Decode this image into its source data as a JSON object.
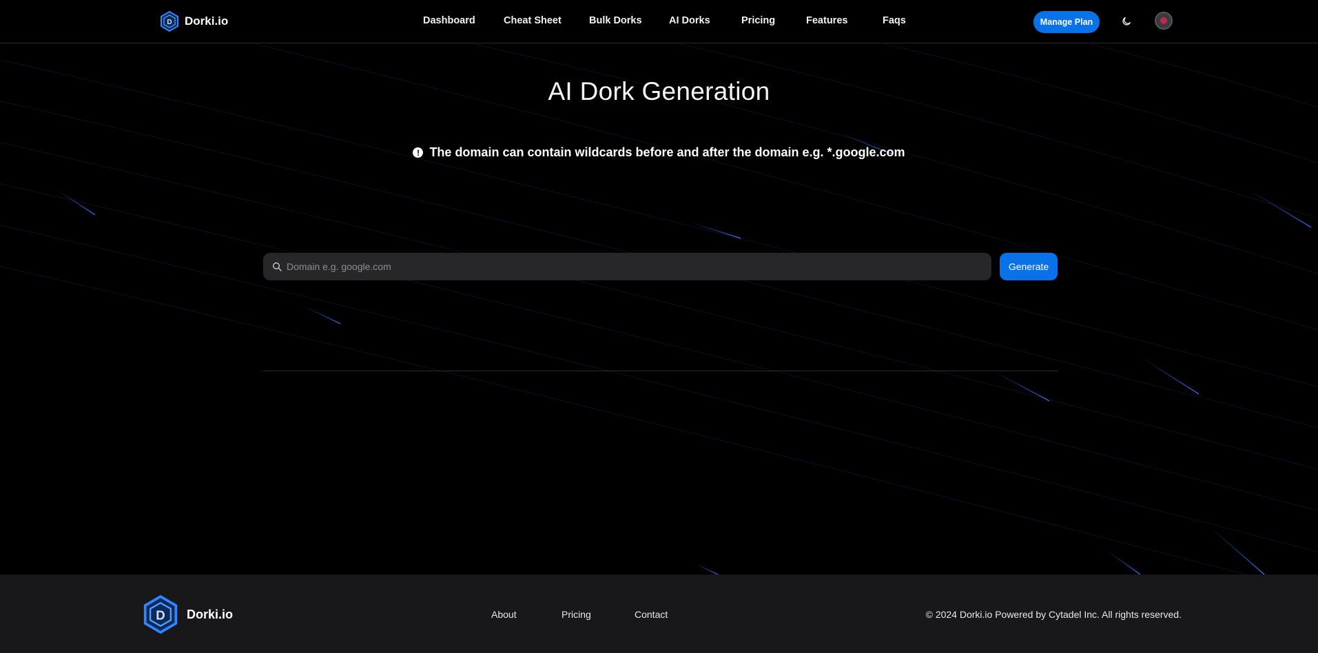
{
  "brand": {
    "name": "Dorki.io"
  },
  "nav": {
    "items": [
      "Dashboard",
      "Cheat Sheet",
      "Bulk Dorks",
      "AI Dorks",
      "Pricing",
      "Features",
      "Faqs"
    ],
    "manage_plan": "Manage Plan"
  },
  "main": {
    "title": "AI Dork Generation",
    "notice": "The domain can contain wildcards before and after the domain e.g. *.google.com",
    "search": {
      "placeholder": "Domain e.g. google.com",
      "value": ""
    },
    "generate_label": "Generate"
  },
  "footer": {
    "brand": "Dorki.io",
    "links": [
      "About",
      "Pricing",
      "Contact"
    ],
    "copyright": "© 2024 Dorki.io Powered by Cytadel Inc. All rights reserved."
  },
  "colors": {
    "accent": "#0a72e8",
    "background": "#000000",
    "footer_bg": "#18181b",
    "input_bg": "#27272a"
  },
  "icons": [
    "logo-icon",
    "moon-icon",
    "search-icon",
    "info-icon"
  ]
}
